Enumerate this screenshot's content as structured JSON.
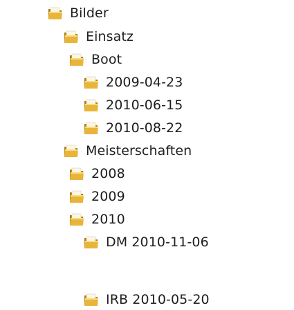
{
  "tree": {
    "nodes": [
      {
        "label": "Bilder",
        "depth": 0
      },
      {
        "label": "Einsatz",
        "depth": 1
      },
      {
        "label": "Boot",
        "depth": 2
      },
      {
        "label": "2009-04-23",
        "depth": 3
      },
      {
        "label": "2010-06-15",
        "depth": 3
      },
      {
        "label": "2010-08-22",
        "depth": 3
      },
      {
        "label": "Meisterschaften",
        "depth": 1
      },
      {
        "label": "2008",
        "depth": 2
      },
      {
        "label": "2009",
        "depth": 2
      },
      {
        "label": "2010",
        "depth": 2
      },
      {
        "label": "DM 2010-11-06",
        "depth": 3
      },
      {
        "label": "IRB 2010-05-20",
        "depth": 3
      }
    ]
  },
  "icons": {
    "folder": "folder-icon"
  },
  "colors": {
    "folder_body": "#e8b53a",
    "folder_dark": "#b07b12",
    "folder_light": "#f7dc7e",
    "folder_page": "#fbf6e6",
    "text": "#1e1e1e"
  }
}
